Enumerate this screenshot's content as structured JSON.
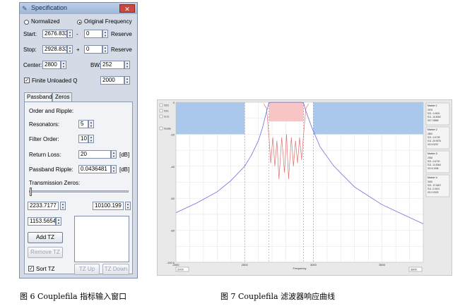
{
  "window": {
    "title": "Specification",
    "close_label": "✕"
  },
  "frequency_mode": {
    "normalized_label": "Normalized",
    "original_label": "Original Frequency",
    "selected": "Original Frequency"
  },
  "start": {
    "label": "Start:",
    "value": "2676.8330",
    "sep": "-",
    "reserve_value": "0",
    "reserve_label": "Reserve"
  },
  "stop": {
    "label": "Stop:",
    "value": "2928.8330",
    "sep": "+",
    "reserve_value": "0",
    "reserve_label": "Reserve"
  },
  "center": {
    "label": "Center:",
    "value": "2800",
    "bw_label": "BW:",
    "bw_value": "252"
  },
  "finite_q": {
    "label": "Finite Unloaded Q",
    "checked": true,
    "q_label": "Q:",
    "q_value": "2000"
  },
  "tabs": [
    {
      "label": "Passband",
      "active": true
    },
    {
      "label": "Zeros",
      "active": false
    }
  ],
  "passband": {
    "heading": "Order and Ripple:",
    "resonators_label": "Resonators:",
    "resonators_value": "5",
    "filter_order_label": "Filter Order:",
    "filter_order_value": "10",
    "return_loss_label": "Return Loss:",
    "return_loss_value": "20",
    "return_loss_unit": "[dB]",
    "ripple_label": "Passband Ripple:",
    "ripple_value": "0.0436481",
    "ripple_unit": "[dB]",
    "tz_heading": "Transmission Zeros:",
    "tz_left_value": "2233.7177",
    "tz_right_value": "10100.199",
    "tz_entry_value": "1153.5654",
    "add_tz": "Add TZ",
    "remove_tz": "Remove TZ",
    "sort_tz_label": "Sort TZ",
    "sort_checked": true,
    "tz_up": "TZ Up",
    "tz_down": "TZ Down"
  },
  "captions": {
    "fig6": "图 6 Couplefila 指标输入窗口",
    "fig7": "图 7 Couplefila 滤波器响应曲线"
  },
  "chart_data": {
    "type": "line",
    "x_range": [
      2000,
      3800
    ],
    "ylim": [
      -100,
      0
    ],
    "yticks": [
      "0",
      "-20",
      "-40",
      "-60",
      "-80",
      "-100.0"
    ],
    "xticks": [
      "2000",
      "2500",
      "3000",
      "3500"
    ],
    "xlabel": "Frequency",
    "start_box": "2000",
    "stop_box": "3800",
    "legend_items": [
      {
        "label": "S21",
        "checked": true
      },
      {
        "label": "S11",
        "checked": true
      },
      {
        "label": "G.D.",
        "checked": false
      }
    ],
    "scale_label": "Scale",
    "colors": {
      "s21": "#6b6be0",
      "s11": "#e07070",
      "stopband": "#a9c8ec",
      "passband": "#f7c5c5"
    },
    "stopbands": [
      {
        "x0": 2000,
        "x1": 2500,
        "y0": 0,
        "y1": -20
      },
      {
        "x0": 3000,
        "x1": 3800,
        "y0": 0,
        "y1": -20
      }
    ],
    "passband_mask": {
      "x0": 2676.833,
      "x1": 2928.833,
      "y0": 0,
      "y1": -12
    },
    "s21": {
      "x": [
        2000,
        2150,
        2300,
        2400,
        2500,
        2550,
        2600,
        2630,
        2650,
        2665,
        2676,
        2690,
        2720,
        2800,
        2880,
        2915,
        2929,
        2940,
        2960,
        2990,
        3050,
        3150,
        3300,
        3500,
        3800
      ],
      "y": [
        -69,
        -63,
        -56,
        -49,
        -40,
        -33,
        -24,
        -16,
        -9,
        -4,
        -0.5,
        -0.05,
        -0.04,
        -0.04,
        -0.04,
        -0.05,
        -0.5,
        -4,
        -9,
        -16,
        -28,
        -40,
        -53,
        -64,
        -76
      ]
    },
    "s11": {
      "x": [
        2640,
        2660,
        2676,
        2690,
        2705,
        2720,
        2735,
        2750,
        2770,
        2790,
        2805,
        2820,
        2840,
        2855,
        2870,
        2885,
        2900,
        2915,
        2929,
        2945,
        2965
      ],
      "y": [
        -1,
        -4,
        -20,
        -38,
        -22,
        -40,
        -24,
        -48,
        -22,
        -44,
        -20,
        -48,
        -22,
        -40,
        -24,
        -38,
        -22,
        -36,
        -20,
        -4,
        -1
      ]
    },
    "markers": [
      {
        "title": "Marker 1",
        "lines": [
          "2676",
          "S21 -0.4651",
          "S11 -16.8052",
          "GD 7.8868"
        ]
      },
      {
        "title": "Marker 2",
        "lines": [
          "2800",
          "S21 -0.0728",
          "S11 -25.9576",
          "GD 6.5297"
        ]
      },
      {
        "title": "Marker 3",
        "lines": [
          "2928",
          "S21 -0.6700",
          "S11 -13.5064",
          "GD 8.1908"
        ]
      },
      {
        "title": "Marker 4",
        "lines": [
          "3150",
          "S21 -37.5607",
          "S11 -0.0401",
          "GD 0.0925"
        ]
      }
    ]
  }
}
